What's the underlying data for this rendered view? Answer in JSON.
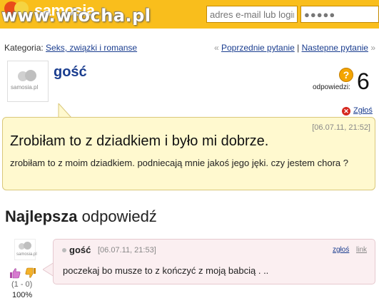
{
  "header": {
    "logo_text": "samosia",
    "watermark": "www.wiocha.pl",
    "email_placeholder": "adres e-mail lub login",
    "password_value": "●●●●●",
    "colors": {
      "bar": "#f9be1c",
      "logo_red": "#e94b1a"
    }
  },
  "category": {
    "label": "Kategoria:",
    "name": "Seks, związki i romanse"
  },
  "nav": {
    "prev_arrow": "«",
    "prev": "Poprzednie pytanie",
    "separator": "|",
    "next": "Nastepne pytanie",
    "next_arrow": "»"
  },
  "question": {
    "author": "gość",
    "avatar_text": "samosia.pl",
    "answers_icon": "question-mark-icon",
    "answers_label": "odpowiedzi:",
    "answers_count": "6",
    "report": "Zgłoś",
    "date": "[06.07.11, 21:52]",
    "title": "Zrobiłam to z dziadkiem i było mi dobrze.",
    "body": "zrobiłam to z moim dziadkiem. podniecają mnie jakoś jego jęki. czy jestem chora ?"
  },
  "best_answer": {
    "heading_bold": "Najlepsza",
    "heading_rest": " odpowiedź",
    "author": "gość",
    "avatar_text": "samosia.pl",
    "date": "[06.07.11, 21:53]",
    "report": "zgłoś",
    "link": "link",
    "body": "poczekaj bo musze to z kończyć z moją babcią . ..",
    "votes": "(1 - 0)",
    "percent": "100%"
  }
}
